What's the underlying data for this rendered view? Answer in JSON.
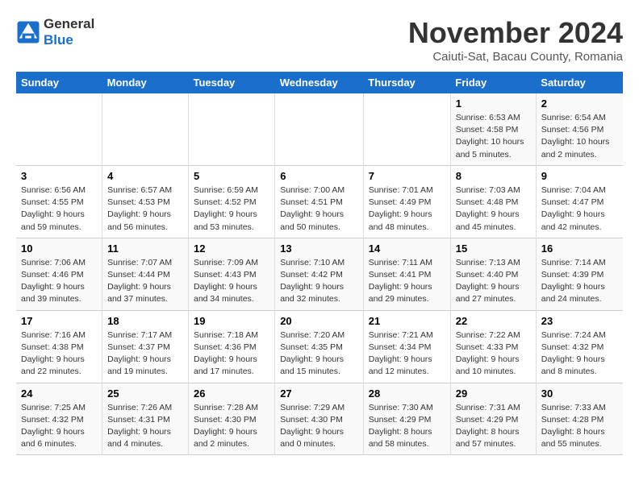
{
  "logo": {
    "text_general": "General",
    "text_blue": "Blue"
  },
  "title": "November 2024",
  "subtitle": "Caiuti-Sat, Bacau County, Romania",
  "days_of_week": [
    "Sunday",
    "Monday",
    "Tuesday",
    "Wednesday",
    "Thursday",
    "Friday",
    "Saturday"
  ],
  "weeks": [
    [
      {
        "day": "",
        "info": ""
      },
      {
        "day": "",
        "info": ""
      },
      {
        "day": "",
        "info": ""
      },
      {
        "day": "",
        "info": ""
      },
      {
        "day": "",
        "info": ""
      },
      {
        "day": "1",
        "info": "Sunrise: 6:53 AM\nSunset: 4:58 PM\nDaylight: 10 hours\nand 5 minutes."
      },
      {
        "day": "2",
        "info": "Sunrise: 6:54 AM\nSunset: 4:56 PM\nDaylight: 10 hours\nand 2 minutes."
      }
    ],
    [
      {
        "day": "3",
        "info": "Sunrise: 6:56 AM\nSunset: 4:55 PM\nDaylight: 9 hours\nand 59 minutes."
      },
      {
        "day": "4",
        "info": "Sunrise: 6:57 AM\nSunset: 4:53 PM\nDaylight: 9 hours\nand 56 minutes."
      },
      {
        "day": "5",
        "info": "Sunrise: 6:59 AM\nSunset: 4:52 PM\nDaylight: 9 hours\nand 53 minutes."
      },
      {
        "day": "6",
        "info": "Sunrise: 7:00 AM\nSunset: 4:51 PM\nDaylight: 9 hours\nand 50 minutes."
      },
      {
        "day": "7",
        "info": "Sunrise: 7:01 AM\nSunset: 4:49 PM\nDaylight: 9 hours\nand 48 minutes."
      },
      {
        "day": "8",
        "info": "Sunrise: 7:03 AM\nSunset: 4:48 PM\nDaylight: 9 hours\nand 45 minutes."
      },
      {
        "day": "9",
        "info": "Sunrise: 7:04 AM\nSunset: 4:47 PM\nDaylight: 9 hours\nand 42 minutes."
      }
    ],
    [
      {
        "day": "10",
        "info": "Sunrise: 7:06 AM\nSunset: 4:46 PM\nDaylight: 9 hours\nand 39 minutes."
      },
      {
        "day": "11",
        "info": "Sunrise: 7:07 AM\nSunset: 4:44 PM\nDaylight: 9 hours\nand 37 minutes."
      },
      {
        "day": "12",
        "info": "Sunrise: 7:09 AM\nSunset: 4:43 PM\nDaylight: 9 hours\nand 34 minutes."
      },
      {
        "day": "13",
        "info": "Sunrise: 7:10 AM\nSunset: 4:42 PM\nDaylight: 9 hours\nand 32 minutes."
      },
      {
        "day": "14",
        "info": "Sunrise: 7:11 AM\nSunset: 4:41 PM\nDaylight: 9 hours\nand 29 minutes."
      },
      {
        "day": "15",
        "info": "Sunrise: 7:13 AM\nSunset: 4:40 PM\nDaylight: 9 hours\nand 27 minutes."
      },
      {
        "day": "16",
        "info": "Sunrise: 7:14 AM\nSunset: 4:39 PM\nDaylight: 9 hours\nand 24 minutes."
      }
    ],
    [
      {
        "day": "17",
        "info": "Sunrise: 7:16 AM\nSunset: 4:38 PM\nDaylight: 9 hours\nand 22 minutes."
      },
      {
        "day": "18",
        "info": "Sunrise: 7:17 AM\nSunset: 4:37 PM\nDaylight: 9 hours\nand 19 minutes."
      },
      {
        "day": "19",
        "info": "Sunrise: 7:18 AM\nSunset: 4:36 PM\nDaylight: 9 hours\nand 17 minutes."
      },
      {
        "day": "20",
        "info": "Sunrise: 7:20 AM\nSunset: 4:35 PM\nDaylight: 9 hours\nand 15 minutes."
      },
      {
        "day": "21",
        "info": "Sunrise: 7:21 AM\nSunset: 4:34 PM\nDaylight: 9 hours\nand 12 minutes."
      },
      {
        "day": "22",
        "info": "Sunrise: 7:22 AM\nSunset: 4:33 PM\nDaylight: 9 hours\nand 10 minutes."
      },
      {
        "day": "23",
        "info": "Sunrise: 7:24 AM\nSunset: 4:32 PM\nDaylight: 9 hours\nand 8 minutes."
      }
    ],
    [
      {
        "day": "24",
        "info": "Sunrise: 7:25 AM\nSunset: 4:32 PM\nDaylight: 9 hours\nand 6 minutes."
      },
      {
        "day": "25",
        "info": "Sunrise: 7:26 AM\nSunset: 4:31 PM\nDaylight: 9 hours\nand 4 minutes."
      },
      {
        "day": "26",
        "info": "Sunrise: 7:28 AM\nSunset: 4:30 PM\nDaylight: 9 hours\nand 2 minutes."
      },
      {
        "day": "27",
        "info": "Sunrise: 7:29 AM\nSunset: 4:30 PM\nDaylight: 9 hours\nand 0 minutes."
      },
      {
        "day": "28",
        "info": "Sunrise: 7:30 AM\nSunset: 4:29 PM\nDaylight: 8 hours\nand 58 minutes."
      },
      {
        "day": "29",
        "info": "Sunrise: 7:31 AM\nSunset: 4:29 PM\nDaylight: 8 hours\nand 57 minutes."
      },
      {
        "day": "30",
        "info": "Sunrise: 7:33 AM\nSunset: 4:28 PM\nDaylight: 8 hours\nand 55 minutes."
      }
    ]
  ]
}
